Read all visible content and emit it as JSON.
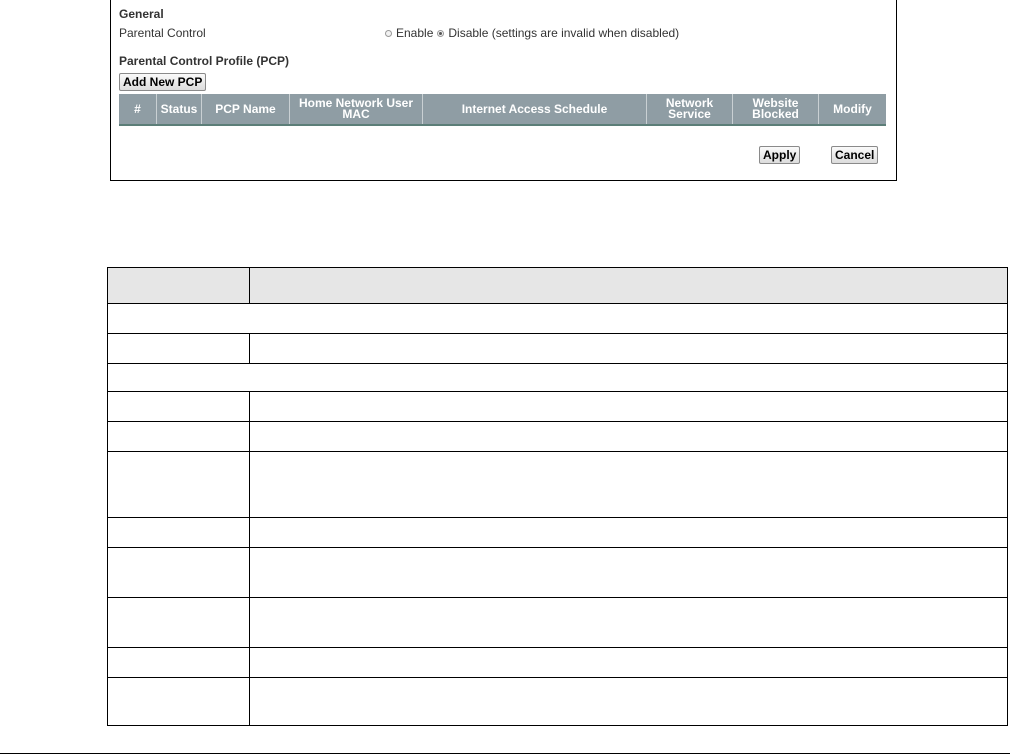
{
  "general": {
    "title": "General",
    "parental_control_label": "Parental Control",
    "enable_label": "Enable",
    "disable_label": "Disable (settings are invalid when disabled)",
    "selected": "disable"
  },
  "pcp": {
    "title": "Parental Control Profile (PCP)",
    "add_button": "Add New PCP",
    "columns": [
      "#",
      "Status",
      "PCP Name",
      "Home Network User MAC",
      "Internet Access Schedule",
      "Network Service",
      "Website Blocked",
      "Modify"
    ]
  },
  "actions": {
    "apply": "Apply",
    "cancel": "Cancel"
  },
  "colors": {
    "table_header_bg": "#8f9da4",
    "table_header_rule": "#5c7e78",
    "ref_header_bg": "#e6e6e6"
  }
}
